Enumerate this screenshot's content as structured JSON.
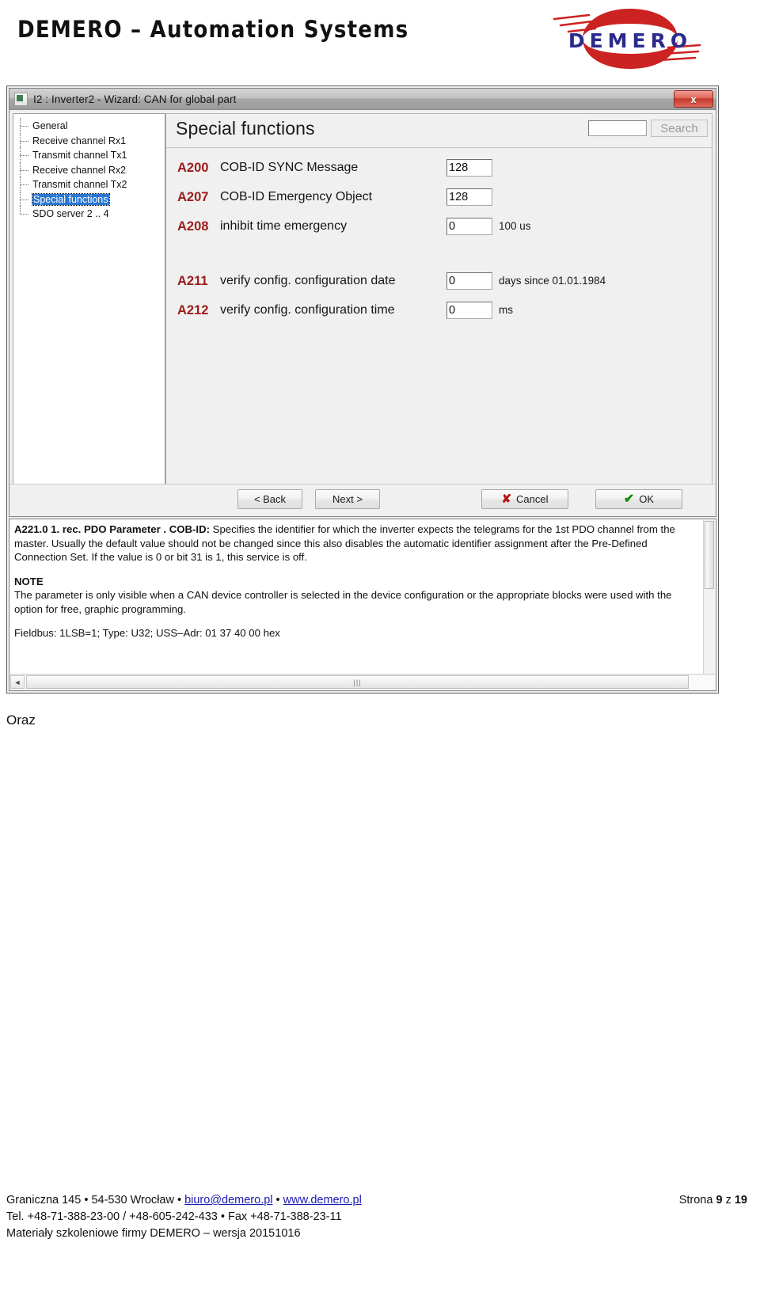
{
  "header": {
    "title": "DEMERO – Automation Systems",
    "logo_text": "DEMERO"
  },
  "dialog": {
    "title": "I2 : Inverter2 - Wizard: CAN for global part",
    "close_label": "x",
    "tree": {
      "items": [
        {
          "label": "General",
          "selected": false
        },
        {
          "label": "Receive channel Rx1",
          "selected": false
        },
        {
          "label": "Transmit channel Tx1",
          "selected": false
        },
        {
          "label": "Receive channel Rx2",
          "selected": false
        },
        {
          "label": "Transmit channel Tx2",
          "selected": false
        },
        {
          "label": "Special functions",
          "selected": true
        },
        {
          "label": "SDO server 2 .. 4",
          "selected": false
        }
      ]
    },
    "panel": {
      "title": "Special functions",
      "search_value": "",
      "search_placeholder": "",
      "search_button": "Search",
      "parameters": [
        {
          "code": "A200",
          "name": "COB-ID SYNC Message",
          "value": "128",
          "unit": ""
        },
        {
          "code": "A207",
          "name": "COB-ID Emergency Object",
          "value": "128",
          "unit": ""
        },
        {
          "code": "A208",
          "name": "inhibit time emergency",
          "value": "0",
          "unit": "100 us"
        },
        {
          "code": "A211",
          "name": "verify config. configuration date",
          "value": "0",
          "unit": "days since 01.01.1984"
        },
        {
          "code": "A212",
          "name": "verify config. configuration time",
          "value": "0",
          "unit": "ms"
        }
      ]
    },
    "buttons": {
      "back": "< Back",
      "next": "Next >",
      "cancel": "Cancel",
      "ok": "OK",
      "cancel_icon": "✘",
      "ok_icon": "✔"
    }
  },
  "note": {
    "param_id": "A221.0  1. rec. PDO Parameter . COB-ID:",
    "paragraph1": " Specifies the identifier for which the inverter expects the telegrams for the 1st PDO channel from the master. Usually the default value should not be changed since this also disables the automatic identifier assignment after the Pre-Defined Connection Set. If the value is 0 or bit 31 is 1, this service is off.",
    "note_heading": "NOTE",
    "note_text": "The parameter is only visible when a CAN device controller is selected in the device configuration or the appropriate blocks were used with the option for free, graphic programming.",
    "fieldbus": "Fieldbus: 1LSB=1; Type: U32; USS–Adr: 01 37 40 00 hex",
    "scroll_left_arrow": "◄",
    "scroll_right_arrow": "►",
    "scroll_grip": "|||"
  },
  "body": {
    "oraz": "Oraz"
  },
  "footer": {
    "address_prefix": "Graniczna 145 • 54-530 Wrocław • ",
    "email": "biuro@demero.pl",
    "sep": " • ",
    "website": "www.demero.pl",
    "phone_line": "Tel. +48-71-388-23-00 / +48-605-242-433 • Fax +48-71-388-23-11",
    "materials_line": "Materiały szkoleniowe firmy DEMERO – wersja 20151016",
    "page_label": "Strona",
    "page_current": "9",
    "page_of": "z",
    "page_total": "19"
  }
}
